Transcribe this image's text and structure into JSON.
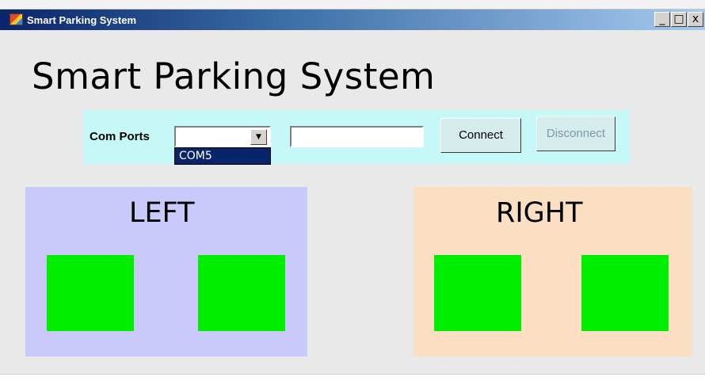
{
  "window": {
    "title": "Smart Parking System",
    "controls": {
      "minimize": "_",
      "maximize": "□",
      "close": "x"
    }
  },
  "main": {
    "heading": "Smart Parking System"
  },
  "com": {
    "label": "Com Ports",
    "selected": "",
    "dropdown_items": [
      "COM5"
    ],
    "text_value": "",
    "connect_label": "Connect",
    "disconnect_label": "Disconnect"
  },
  "left": {
    "title": "LEFT",
    "slots": [
      {
        "status_color": "#00ee00"
      },
      {
        "status_color": "#00ee00"
      }
    ]
  },
  "right": {
    "title": "RIGHT",
    "slots": [
      {
        "status_color": "#00ee00"
      },
      {
        "status_color": "#00ee00"
      }
    ]
  },
  "colors": {
    "left_panel": "#c9c9fb",
    "right_panel": "#fbdfc2",
    "com_panel": "#c7f8f8",
    "slot_free": "#00ee00"
  }
}
